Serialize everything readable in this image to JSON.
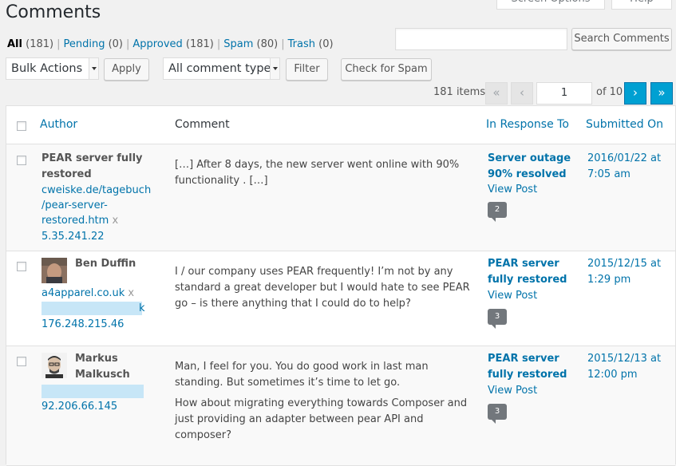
{
  "header": {
    "title": "Comments",
    "screen_options_label": "Screen Options",
    "help_label": "Help"
  },
  "filters": [
    {
      "label": "All",
      "count": "(181)"
    },
    {
      "label": "Pending",
      "count": "(0)"
    },
    {
      "label": "Approved",
      "count": "(181)"
    },
    {
      "label": "Spam",
      "count": "(80)"
    },
    {
      "label": "Trash",
      "count": "(0)"
    }
  ],
  "search": {
    "value": "",
    "button_label": "Search Comments"
  },
  "toolbar": {
    "bulk_actions": "Bulk Actions",
    "apply": "Apply",
    "comment_types": "All comment types",
    "filter": "Filter",
    "check_spam": "Check for Spam"
  },
  "pagination": {
    "items": "181 items",
    "first": "«",
    "prev": "‹",
    "current_page": "1",
    "of": "of 10",
    "next": "›",
    "last": "»"
  },
  "columns": {
    "author": "Author",
    "comment": "Comment",
    "response": "In Response To",
    "submitted": "Submitted On"
  },
  "rows": [
    {
      "author_name_1": "PEAR server fully",
      "author_name_2": "restored",
      "url_1": "cweiske.de/tagebuch",
      "url_2": "/pear-server-",
      "url_3": "restored.htm",
      "x": "x",
      "ip": "5.35.241.22",
      "comment_1": "[…] After 8 days, the new server went online with 90% functionality . […]",
      "response_1": "Server outage",
      "response_2": "90% resolved",
      "view_post": "View Post",
      "count": "2",
      "date_1": "2016/01/22 at",
      "date_2": "7:05 am"
    },
    {
      "author_name_1": "Ben Duffin",
      "url_1": "a4apparel.co.uk",
      "x": "x",
      "email_tail": "k",
      "ip": "176.248.215.46",
      "comment_1": "I / our company uses PEAR frequently! I’m not by any standard a great developer but I would hate to see PEAR go – is there anything that I could do to help?",
      "response_1": "PEAR server",
      "response_2": "fully restored",
      "view_post": "View Post",
      "count": "3",
      "date_1": "2015/12/15 at",
      "date_2": "1:29 pm"
    },
    {
      "author_name_1": "Markus",
      "author_name_2": "Malkusch",
      "ip": "92.206.66.145",
      "comment_1": "Man, I feel for you. You do good work in last man standing. But sometimes it’s time to let go.",
      "comment_2": "How about migrating everything towards Composer and just providing an adapter between pear API and composer?",
      "response_1": "PEAR server",
      "response_2": "fully restored",
      "view_post": "View Post",
      "count": "3",
      "date_1": "2015/12/13 at",
      "date_2": "12:00 pm"
    }
  ]
}
